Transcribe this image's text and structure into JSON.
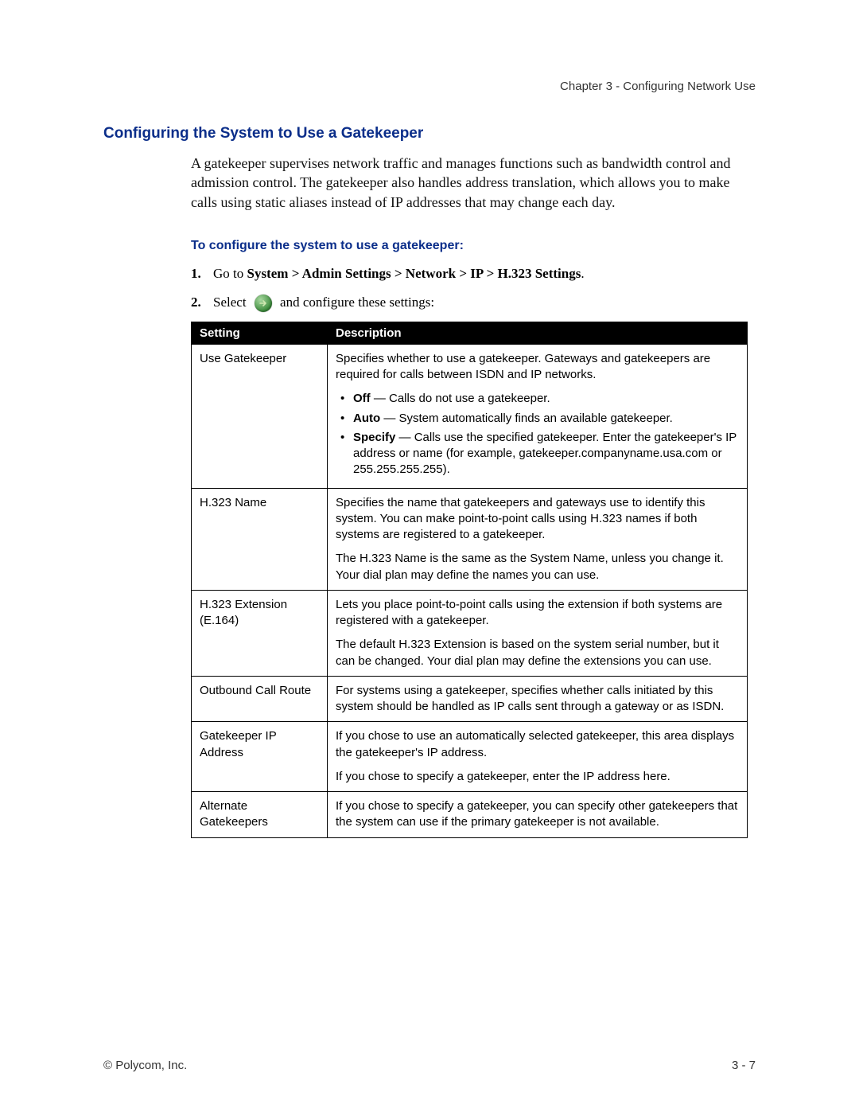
{
  "header": {
    "chapter": "Chapter 3 - Configuring Network Use"
  },
  "section": {
    "title": "Configuring the System to Use a Gatekeeper",
    "intro": "A gatekeeper supervises network traffic and manages functions such as bandwidth control and admission control. The gatekeeper also handles address translation, which allows you to make calls using static aliases instead of IP addresses that may change each day."
  },
  "procedure": {
    "title": "To configure the system to use a gatekeeper:",
    "step1_prefix": "Go to ",
    "step1_nav": "System > Admin Settings > Network > IP > H.323 Settings",
    "step1_suffix": ".",
    "step2_prefix": "Select",
    "step2_suffix": "and configure these settings:"
  },
  "table": {
    "col1": "Setting",
    "col2": "Description",
    "rows": {
      "r1": {
        "setting": "Use Gatekeeper",
        "p1": "Specifies whether to use a gatekeeper. Gateways and gatekeepers are required for calls between ISDN and IP networks.",
        "b1_label": "Off",
        "b1_text": " — Calls do not use a gatekeeper.",
        "b2_label": "Auto",
        "b2_text": " — System automatically finds an available gatekeeper.",
        "b3_label": "Specify",
        "b3_text": " — Calls use the specified gatekeeper. Enter the gatekeeper's IP address or name (for example, gatekeeper.companyname.usa.com or 255.255.255.255)."
      },
      "r2": {
        "setting": "H.323 Name",
        "p1": "Specifies the name that gatekeepers and gateways use to identify this system. You can make point-to-point calls using H.323 names if both systems are registered to a gatekeeper.",
        "p2": "The H.323 Name is the same as the System Name, unless you change it. Your dial plan may define the names you can use."
      },
      "r3": {
        "setting": "H.323 Extension (E.164)",
        "p1": "Lets you place point-to-point calls using the extension if both systems are registered with a gatekeeper.",
        "p2": "The default H.323 Extension is based on the system serial number, but it can be changed. Your dial plan may define the extensions you can use."
      },
      "r4": {
        "setting": "Outbound Call Route",
        "p1": "For systems using a gatekeeper, specifies whether calls initiated by this system should be handled as IP calls sent through a gateway or as ISDN."
      },
      "r5": {
        "setting": "Gatekeeper IP Address",
        "p1": "If you chose to use an automatically selected gatekeeper, this area displays the gatekeeper's IP address.",
        "p2": "If you chose to specify a gatekeeper, enter the IP address here."
      },
      "r6": {
        "setting": "Alternate Gatekeepers",
        "p1": "If you chose to specify a gatekeeper, you can specify other gatekeepers that the system can use if the primary gatekeeper is not available."
      }
    }
  },
  "footer": {
    "left": "© Polycom, Inc.",
    "right": "3 - 7"
  }
}
